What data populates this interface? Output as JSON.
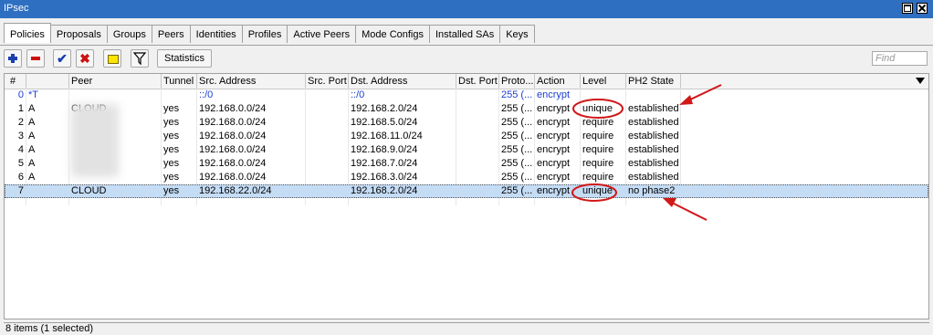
{
  "window": {
    "title": "IPsec"
  },
  "tabs": [
    "Policies",
    "Proposals",
    "Groups",
    "Peers",
    "Identities",
    "Profiles",
    "Active Peers",
    "Mode Configs",
    "Installed SAs",
    "Keys"
  ],
  "toolbar": {
    "add_icon": "plus-icon",
    "remove_icon": "minus-icon",
    "enable_icon": "check-icon",
    "disable_icon": "cross-icon",
    "comment_icon": "note-icon",
    "filter_icon": "filter-icon",
    "statistics_label": "Statistics",
    "find_placeholder": "Find"
  },
  "columns": [
    "#",
    "",
    "Peer",
    "Tunnel",
    "Src. Address",
    "Src. Port",
    "Dst. Address",
    "Dst. Port",
    "Proto...",
    "Action",
    "Level",
    "PH2 State"
  ],
  "rows": [
    {
      "num": "0",
      "flags": "*T",
      "peer": "",
      "tunnel": "",
      "src": "::/0",
      "src_port": "",
      "dst": "::/0",
      "dst_port": "",
      "proto": "255 (...",
      "action": "encrypt",
      "level": "",
      "ph2": ""
    },
    {
      "num": "1",
      "flags": "A",
      "peer": "CLOUD",
      "tunnel": "yes",
      "src": "192.168.0.0/24",
      "src_port": "",
      "dst": "192.168.2.0/24",
      "dst_port": "",
      "proto": "255 (...",
      "action": "encrypt",
      "level": "unique",
      "ph2": "established"
    },
    {
      "num": "2",
      "flags": "A",
      "peer": "",
      "tunnel": "yes",
      "src": "192.168.0.0/24",
      "src_port": "",
      "dst": "192.168.5.0/24",
      "dst_port": "",
      "proto": "255 (...",
      "action": "encrypt",
      "level": "require",
      "ph2": "established"
    },
    {
      "num": "3",
      "flags": "A",
      "peer": "",
      "tunnel": "yes",
      "src": "192.168.0.0/24",
      "src_port": "",
      "dst": "192.168.11.0/24",
      "dst_port": "",
      "proto": "255 (...",
      "action": "encrypt",
      "level": "require",
      "ph2": "established"
    },
    {
      "num": "4",
      "flags": "A",
      "peer": "",
      "tunnel": "yes",
      "src": "192.168.0.0/24",
      "src_port": "",
      "dst": "192.168.9.0/24",
      "dst_port": "",
      "proto": "255 (...",
      "action": "encrypt",
      "level": "require",
      "ph2": "established"
    },
    {
      "num": "5",
      "flags": "A",
      "peer": "",
      "tunnel": "yes",
      "src": "192.168.0.0/24",
      "src_port": "",
      "dst": "192.168.7.0/24",
      "dst_port": "",
      "proto": "255 (...",
      "action": "encrypt",
      "level": "require",
      "ph2": "established"
    },
    {
      "num": "6",
      "flags": "A",
      "peer": "",
      "tunnel": "yes",
      "src": "192.168.0.0/24",
      "src_port": "",
      "dst": "192.168.3.0/24",
      "dst_port": "",
      "proto": "255 (...",
      "action": "encrypt",
      "level": "require",
      "ph2": "established"
    },
    {
      "num": "7",
      "flags": "",
      "peer": "CLOUD",
      "tunnel": "yes",
      "src": "192.168.22.0/24",
      "src_port": "",
      "dst": "192.168.2.0/24",
      "dst_port": "",
      "proto": "255 (...",
      "action": "encrypt",
      "level": "unique",
      "ph2": "no phase2"
    }
  ],
  "status_bar": {
    "text": "8 items (1 selected)"
  },
  "colors": {
    "titlebar": "#2f6fc1",
    "selection": "#c5dcf5",
    "default_row": "#1a3fd0",
    "annotation": "#d01818"
  }
}
